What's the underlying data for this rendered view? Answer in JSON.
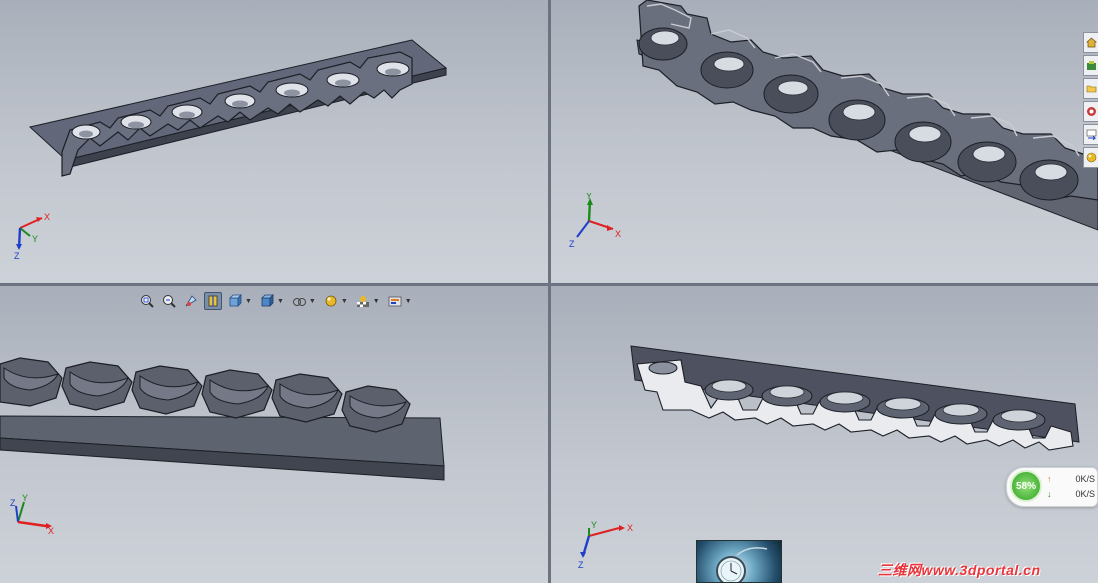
{
  "viewports": [
    {
      "id": "top-left",
      "triad": {
        "x": "X",
        "y": "Y",
        "z": "Z"
      }
    },
    {
      "id": "top-right",
      "triad": {
        "x": "X",
        "y": "Y",
        "z": "Z"
      }
    },
    {
      "id": "bottom-left",
      "triad": {
        "y": "Y",
        "z": "Z",
        "x": "X"
      }
    },
    {
      "id": "bottom-right",
      "triad": {
        "x": "X",
        "y": "Y",
        "z": "Z"
      }
    }
  ],
  "heads_up_toolbar": [
    {
      "icon": "zoom-to-fit-icon"
    },
    {
      "icon": "zoom-area-icon"
    },
    {
      "icon": "previous-view-icon"
    },
    {
      "icon": "section-view-icon",
      "active": true
    },
    {
      "icon": "view-orientation-icon",
      "dropdown": true
    },
    {
      "icon": "display-style-icon",
      "dropdown": true
    },
    {
      "icon": "hide-show-items-icon",
      "dropdown": true
    },
    {
      "icon": "edit-appearance-icon",
      "dropdown": true
    },
    {
      "icon": "apply-scene-icon",
      "dropdown": true
    },
    {
      "icon": "view-settings-icon",
      "dropdown": true
    }
  ],
  "task_pane_tabs": [
    {
      "icon": "home-icon"
    },
    {
      "icon": "design-library-icon"
    },
    {
      "icon": "file-explorer-icon"
    },
    {
      "icon": "search-icon"
    },
    {
      "icon": "view-palette-icon"
    },
    {
      "icon": "appearances-icon"
    }
  ],
  "network_widget": {
    "percent": "58%",
    "upload": "0K/S",
    "download": "0K/S",
    "colors": {
      "ring": "#4cb53a",
      "up": "#e07a1f",
      "down": "#2f8d24"
    }
  },
  "watermark": "三维网www.3dportal.cn",
  "colors": {
    "part": "#5f6470",
    "part_edge": "#1c1f26",
    "viewport_bg": "#bfc4cc",
    "axis_x": "#e02020",
    "axis_y": "#1a8a1a",
    "axis_z": "#1f3fc8"
  }
}
